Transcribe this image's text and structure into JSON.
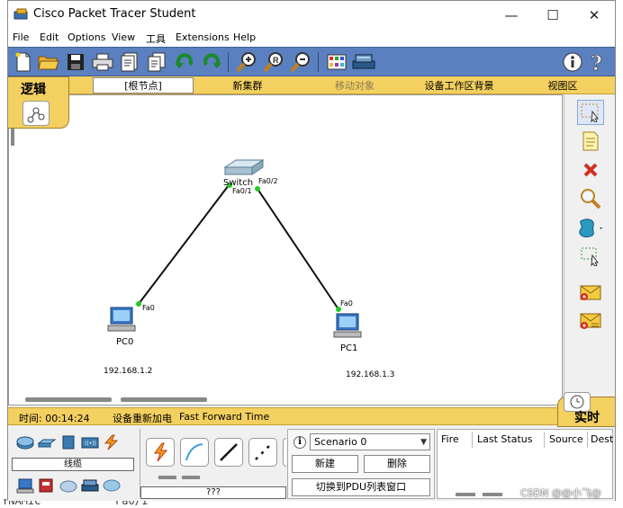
{
  "background": {
    "bottom_text_left": "YNAMIC",
    "bottom_text_right": "Fa0/1"
  },
  "window": {
    "title": "Cisco Packet Tracer Student",
    "controls": {
      "minimize": "—",
      "maximize": "☐",
      "close": "✕"
    }
  },
  "menu": {
    "file": "File",
    "edit": "Edit",
    "options": "Options",
    "view": "View",
    "tools": "工具",
    "extensions": "Extensions",
    "help": "Help"
  },
  "modebar": {
    "logic": "逻辑",
    "root": "[根节点]",
    "new_cluster": "新集群",
    "move_object": "移动对象",
    "set_background": "设备工作区背景",
    "viewport": "视图区"
  },
  "topology": {
    "switch": {
      "name": "Switch",
      "port_a": "Fa0/1",
      "port_b": "Fa0/2"
    },
    "pc0": {
      "name": "PC0",
      "port": "Fa0",
      "ip": "192.168.1.2"
    },
    "pc1": {
      "name": "PC1",
      "port": "Fa0",
      "ip": "192.168.1.3"
    }
  },
  "status": {
    "time_label": "时间: 00:14:24",
    "power_cycle": "设备重新加电",
    "fast_forward": "Fast Forward Time",
    "realtime": "实时"
  },
  "devices": {
    "category_name": "线缆",
    "device_name": "???"
  },
  "scenario": {
    "info": "i",
    "selected": "Scenario 0",
    "new_label": "新建",
    "delete_label": "删除",
    "toggle_pdu": "切换到PDU列表窗口"
  },
  "pdu_table": {
    "columns": [
      "Fire",
      "Last Status",
      "Source",
      "Dest"
    ]
  },
  "watermark": "CSDN @@小飞@"
}
